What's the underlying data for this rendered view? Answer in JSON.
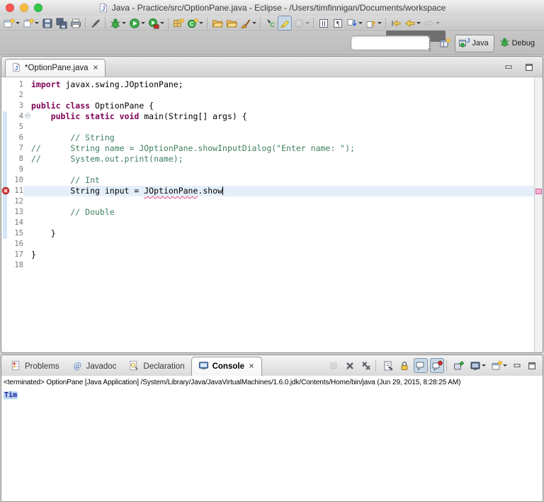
{
  "window": {
    "title": "Java - Practice/src/OptionPane.java - Eclipse - /Users/timfinnigan/Documents/workspace"
  },
  "colors": {
    "traffic_red": "#fc5753",
    "traffic_yellow": "#fdbc40",
    "traffic_green": "#34c84a",
    "keyword": "#7f0055",
    "comment": "#3f7f5f",
    "current_line": "#e4effa",
    "spell_underline": "#dfa23c",
    "error_underline": "#e0407a",
    "stdin_blue": "#1c1c9e",
    "selection": "#b9d6f2",
    "error_badge": "#cc2b2b",
    "overview_marker": "#f6b2d4"
  },
  "toolbar_main": {
    "buttons": [
      {
        "name": "new-wizard-button",
        "icon": "new-wizard",
        "dropdown": true
      },
      {
        "name": "new-menu-button",
        "icon": "new-menu",
        "dropdown": true
      },
      {
        "name": "save-button",
        "icon": "save"
      },
      {
        "name": "save-all-button",
        "icon": "save-all"
      },
      {
        "name": "print-button",
        "icon": "print"
      },
      {
        "sep": true
      },
      {
        "name": "skip-breakpoints-button",
        "icon": "skip-breakpoints"
      },
      {
        "sep": true
      },
      {
        "name": "debug-button",
        "icon": "debug",
        "dropdown": true
      },
      {
        "name": "run-button",
        "icon": "run",
        "dropdown": true
      },
      {
        "name": "external-tools-button",
        "icon": "run-external",
        "dropdown": true
      },
      {
        "sep": true
      },
      {
        "name": "new-java-project-button",
        "icon": "new-java-project"
      },
      {
        "name": "new-java-class-button",
        "icon": "new-java-class",
        "dropdown": true
      },
      {
        "sep": true
      },
      {
        "name": "open-type-button",
        "icon": "open-folder"
      },
      {
        "name": "search-button",
        "icon": "open-folder"
      },
      {
        "name": "open-element-button",
        "icon": "brush",
        "dropdown": true
      },
      {
        "sep": true
      },
      {
        "name": "java-editor-button",
        "icon": "class-c"
      },
      {
        "name": "mark-occurrences-button",
        "icon": "mark-occurrences",
        "pressed": true
      },
      {
        "name": "build-button",
        "icon": "disabled-run",
        "dropdown": true,
        "disabled": true
      },
      {
        "sep": true
      },
      {
        "name": "show-source-columns-button",
        "icon": "show-columns"
      },
      {
        "name": "show-whitespace-button",
        "icon": "show-whitespace"
      },
      {
        "name": "next-annotation-button",
        "icon": "next-annotation",
        "dropdown": true
      },
      {
        "name": "previous-annotation-button",
        "icon": "prev-annotation",
        "dropdown": true
      },
      {
        "sep": true
      },
      {
        "name": "last-edit-location-button",
        "icon": "last-edit"
      },
      {
        "name": "back-button",
        "icon": "back",
        "dropdown": true
      },
      {
        "name": "forward-button",
        "icon": "forward",
        "dropdown": true,
        "disabled": true
      }
    ]
  },
  "quick_access": {
    "value": ""
  },
  "perspectives": {
    "items": [
      {
        "label": "Java",
        "icon": "java-persp",
        "active": true
      },
      {
        "label": "Debug",
        "icon": "debug-persp",
        "active": false
      }
    ]
  },
  "editor": {
    "tab_label": "*OptionPane.java",
    "range": {
      "from": 4,
      "to": 15
    },
    "overview_markers": [
      {
        "line": 11
      }
    ],
    "lines": [
      {
        "n": 1,
        "segs": [
          {
            "t": "import",
            "s": "k"
          },
          {
            "t": " javax.swing.JOptionPane;",
            "s": "p"
          }
        ]
      },
      {
        "n": 2,
        "segs": []
      },
      {
        "n": 3,
        "segs": [
          {
            "t": "public class",
            "s": "k"
          },
          {
            "t": " OptionPane {",
            "s": "p"
          }
        ]
      },
      {
        "n": 4,
        "fold": true,
        "segs": [
          {
            "t": "    ",
            "s": "p"
          },
          {
            "t": "public static void",
            "s": "k"
          },
          {
            "t": " main(String[] args) {",
            "s": "p"
          }
        ]
      },
      {
        "n": 5,
        "segs": []
      },
      {
        "n": 6,
        "segs": [
          {
            "t": "        // String",
            "s": "c"
          }
        ]
      },
      {
        "n": 7,
        "segs": [
          {
            "t": "//      String name = JOptionPane.showInputDialog(\"Enter name: \");",
            "s": "c"
          }
        ]
      },
      {
        "n": 8,
        "segs": [
          {
            "t": "//      System.out.print(name);",
            "s": "c"
          }
        ]
      },
      {
        "n": 9,
        "segs": []
      },
      {
        "n": 10,
        "segs": [
          {
            "t": "        // ",
            "s": "c"
          },
          {
            "t": "Int",
            "s": "cs"
          }
        ]
      },
      {
        "n": 11,
        "error": true,
        "current": true,
        "caret": true,
        "segs": [
          {
            "t": "        String input = ",
            "s": "p"
          },
          {
            "t": "JOptionPane",
            "s": "e"
          },
          {
            "t": ".show",
            "s": "p"
          }
        ]
      },
      {
        "n": 12,
        "segs": []
      },
      {
        "n": 13,
        "segs": [
          {
            "t": "        // Double",
            "s": "c"
          }
        ]
      },
      {
        "n": 14,
        "segs": []
      },
      {
        "n": 15,
        "segs": [
          {
            "t": "    }",
            "s": "p"
          }
        ]
      },
      {
        "n": 16,
        "segs": []
      },
      {
        "n": 17,
        "segs": [
          {
            "t": "}",
            "s": "p"
          }
        ]
      },
      {
        "n": 18,
        "segs": []
      }
    ]
  },
  "bottom": {
    "tabs": [
      {
        "name": "tab-problems",
        "label": "Problems",
        "icon": "problems-icon"
      },
      {
        "name": "tab-javadoc",
        "label": "Javadoc",
        "icon": "javadoc-icon"
      },
      {
        "name": "tab-declaration",
        "label": "Declaration",
        "icon": "declaration-icon"
      },
      {
        "name": "tab-console",
        "label": "Console",
        "icon": "console-icon",
        "active": true,
        "closable": true
      }
    ],
    "toolbar": [
      {
        "name": "terminate-button",
        "icon": "terminate",
        "disabled": true
      },
      {
        "name": "remove-launch-button",
        "icon": "remove-launch"
      },
      {
        "name": "remove-all-launches-button",
        "icon": "remove-all"
      },
      {
        "sep": true
      },
      {
        "name": "clear-console-button",
        "icon": "clear-console"
      },
      {
        "name": "scroll-lock-button",
        "icon": "scroll-lock"
      },
      {
        "name": "show-stdout-button",
        "icon": "show-stdout",
        "pressed": true
      },
      {
        "name": "show-stderr-button",
        "icon": "show-stderr",
        "pressed": true
      },
      {
        "sep": true
      },
      {
        "name": "pin-console-button",
        "icon": "pin-console"
      },
      {
        "name": "display-console-button",
        "icon": "display-console",
        "dropdown": true
      },
      {
        "name": "open-console-button",
        "icon": "open-console",
        "dropdown": true
      },
      {
        "name": "minimize-view-button",
        "icon": "minimize-view"
      },
      {
        "name": "maximize-view-button",
        "icon": "maximize-view"
      }
    ]
  },
  "console": {
    "header": "<terminated> OptionPane [Java Application] /System/Library/Java/JavaVirtualMachines/1.6.0.jdk/Contents/Home/bin/java (Jun 29, 2015, 8:28:25 AM)",
    "output": "Tim"
  }
}
